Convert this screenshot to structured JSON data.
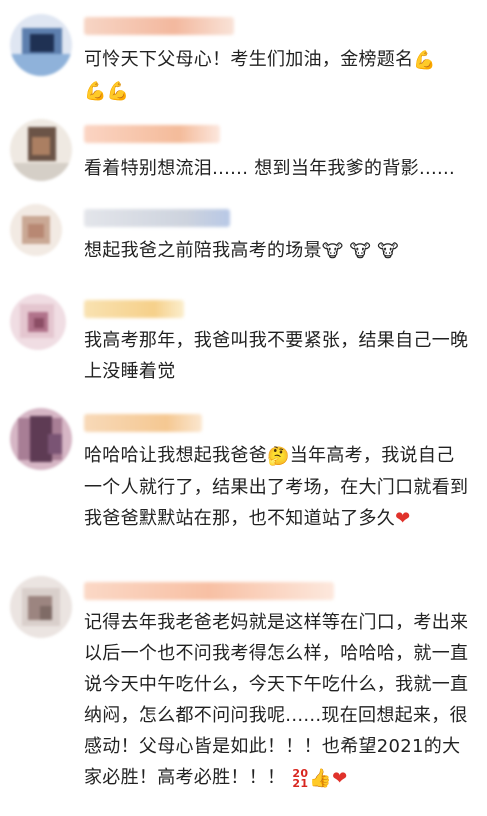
{
  "comments": [
    {
      "text": "可怜天下父母心！考生们加油，金榜题名",
      "emoji_after": "💪",
      "line2_emojis": [
        "💪",
        "💪"
      ],
      "avatar_colors": [
        "#dfe6f2",
        "#5d7fae",
        "#1f3153",
        "#8fb2da"
      ],
      "username_colors": [
        "#f7d5c5",
        "#f3b89e",
        "#f9e3d8"
      ]
    },
    {
      "text": "看着特别想流泪...... 想到当年我爹的背影......",
      "avatar_colors": [
        "#d5cfc7",
        "#6b5447",
        "#ab7f62",
        "#efe9e2"
      ],
      "username_colors": [
        "#fbd4c3",
        "#f4bb9a",
        "#fce7de"
      ]
    },
    {
      "text": "想起我爸之前陪我高考的场景",
      "emojis": [
        "🐮",
        "🐮",
        "🐮"
      ],
      "avatar_colors": [
        "#e8ddd4",
        "#caa895",
        "#f2eae3",
        "#b88873"
      ],
      "username_colors": [
        "#e3e5ea",
        "#cdd3de",
        "#b8c8e6"
      ]
    },
    {
      "text": "我高考那年，我爸叫我不要紧张，结果自己一晚上没睡着觉",
      "avatar_colors": [
        "#e4c6cf",
        "#b1738b",
        "#f0dde3",
        "#8c4e65"
      ],
      "username_colors": [
        "#f9e2b1",
        "#f6d08a",
        "#fbeecd"
      ]
    },
    {
      "text_part1": "哈哈哈让我想起我爸爸",
      "thinking_emoji": "🤔",
      "text_part2": "当年高考，我说自己一个人就行了，结果出了考场，在大门口就看到我爸爸默默站在那，也不知道站了多久",
      "heart_emoji": "❤",
      "avatar_colors": [
        "#a87e95",
        "#5e3b54",
        "#d6b6c5",
        "#7a5474"
      ],
      "username_colors": [
        "#f8d9b8",
        "#f5c892",
        "#fbe7d0"
      ]
    },
    {
      "text": "记得去年我老爸老妈就是这样等在门口，考出来以后一个也不问我考得怎么样，哈哈哈，就一直说今天中午吃什么，今天下午吃什么，我就一直纳闷，怎么都不问问我呢......现在回想起来，很感动！父母心皆是如此！！！也希望2021的大家必胜！高考必胜！！！",
      "sticker_text": "2021",
      "thumbs_emoji": "👍",
      "heart_emoji": "❤",
      "avatar_colors": [
        "#d9cfcb",
        "#9c8580",
        "#ebe4e1",
        "#7f6b66"
      ],
      "username_colors": [
        "#fbd8c6",
        "#f8c0a4",
        "#fde8dd"
      ]
    }
  ]
}
